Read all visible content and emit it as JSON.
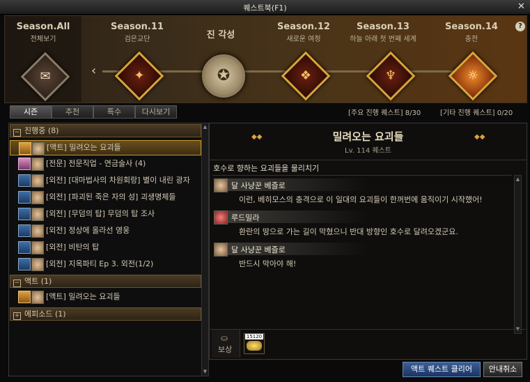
{
  "window": {
    "title": "퀘스트북(F1)",
    "close_label": "✕"
  },
  "banner": {
    "help": "?",
    "seasons": [
      {
        "name": "Season.All",
        "sub": "전체보기"
      },
      {
        "name": "Season.11",
        "sub": "검은교단"
      },
      {
        "name": "진 각성",
        "sub": ""
      },
      {
        "name": "Season.12",
        "sub": "새로운 여정"
      },
      {
        "name": "Season.13",
        "sub": "하늘 아래 첫 번째 세계"
      },
      {
        "name": "Season.14",
        "sub": "충전"
      }
    ]
  },
  "tabs": [
    "시즌",
    "추천",
    "특수",
    "다시보기"
  ],
  "counts": {
    "main": "[주요 진행 퀘스트] 8/30",
    "other": "[기타 진행 퀘스트] 0/20"
  },
  "groups": {
    "progress": "진행중 (8)",
    "act": "액트 (1)",
    "episode": "에피소드 (1)"
  },
  "quests": [
    "[액트] 밀려오는 요괴들",
    "[전문] 전문직업 - 연금술사 (4)",
    "[외전] [대마법사의 차원회랑] 별이 내린 광자",
    "[외전] [파괴된 죽은 자의 성] 괴생명체들",
    "[외전] [무덤의 탑] 무덤의 탑 조사",
    "[외전] 정상에 올라선 영웅",
    "[외전] 비탄의 탑",
    "[외전] 지옥파티 Ep 3. 외전(1/2)"
  ],
  "act_quests": [
    "[액트] 밀려오는 요괴들"
  ],
  "detail": {
    "title": "밀려오는 요괴들",
    "subtitle": "Lv. 114 퀘스트",
    "description": "호수로 향하는 요괴들을 물리치기",
    "dialog": [
      {
        "speaker": "달 사냥꾼 베즐로",
        "line": "이런, 베히모스의 충격으로 이 일대의 요괴들이 한꺼번에 움직이기 시작했어!"
      },
      {
        "speaker": "루드밀라",
        "line": "환란의 땅으로 가는 길이 막혔으니 반대 방향인 호수로 달려오겠군요."
      },
      {
        "speaker": "달 사냥꾼 베즐로",
        "line": "반드시 막아야 해!"
      }
    ]
  },
  "reward": {
    "label": "보상",
    "amount": "15120"
  },
  "buttons": {
    "clear": "액트 퀘스트 클리어",
    "guide_cancel": "안내취소"
  }
}
